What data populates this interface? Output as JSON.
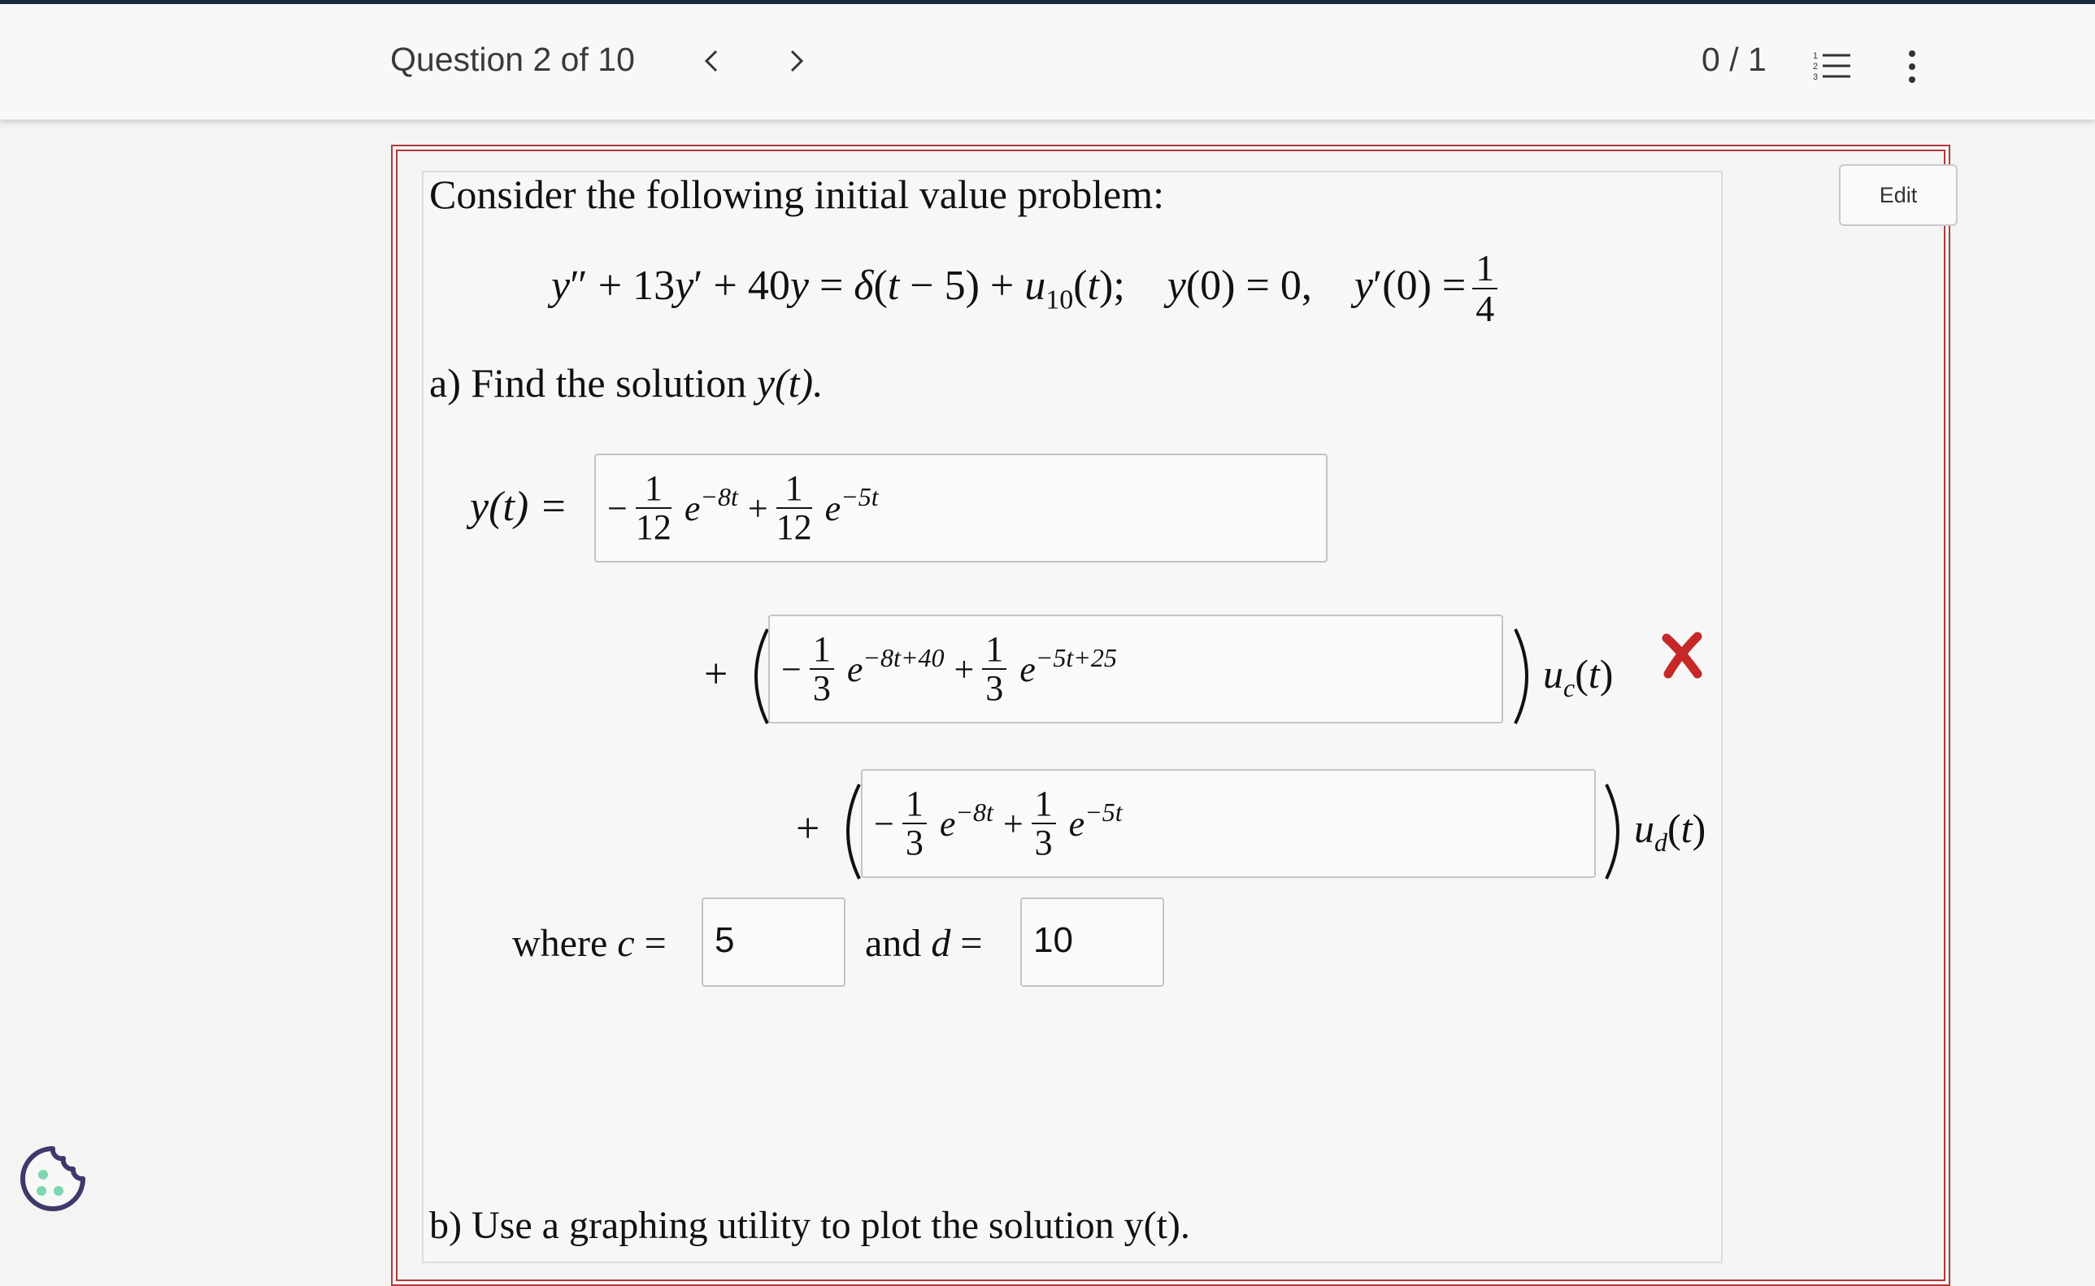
{
  "header": {
    "question_label": "Question 2 of 10",
    "score": "0 / 1",
    "icons": [
      "chevron-left-icon",
      "chevron-right-icon",
      "numbered-list-icon",
      "more-vertical-icon"
    ]
  },
  "edit_label": "Edit",
  "problem": {
    "intro": "Consider the following initial value problem:",
    "part_a": "a) Find the solution",
    "part_a_var": "y(t).",
    "part_b": "b) Use a graphing utility to plot the solution y(t)."
  },
  "answers": {
    "y_t": {
      "label": "y(t) =",
      "term1_sign": "−",
      "term1_num": "1",
      "term1_den": "12",
      "term1_exp": "−8t",
      "term2_sign": "+",
      "term2_num": "1",
      "term2_den": "12",
      "term2_exp": "−5t"
    },
    "u_c_coeff": {
      "term1_sign": "−",
      "term1_num": "1",
      "term1_den": "3",
      "term1_exp": "−8t+40",
      "term2_sign": "+",
      "term2_num": "1",
      "term2_den": "3",
      "term2_exp": "−5t+25",
      "status": "incorrect"
    },
    "u_d_coeff": {
      "term1_sign": "−",
      "term1_num": "1",
      "term1_den": "3",
      "term1_exp": "−8t",
      "term2_sign": "+",
      "term2_num": "1",
      "term2_den": "3",
      "term2_exp": "−5t"
    },
    "c_label": "where",
    "c_value": "5",
    "d_label": "and",
    "d_value": "10"
  },
  "colors": {
    "frame": "#b23a3a",
    "incorrect": "#c62828",
    "cookie": "#3d3a6b",
    "cookie_dots": "#7fd6b0"
  }
}
